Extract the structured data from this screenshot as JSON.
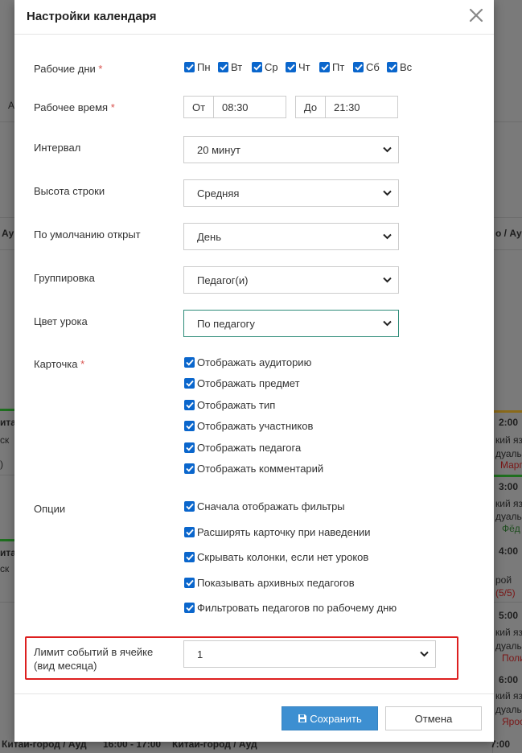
{
  "background": {
    "fragments": [
      "Ау",
      "А",
      "о / Ау",
      "ита",
      "ск",
      ")",
      "ита",
      "ск",
      "2:00",
      "кий яз",
      "дуалы",
      "Марг",
      "3:00",
      "кий яз",
      "дуаль",
      "Фёд",
      "4:00",
      "рой",
      "(5/5)",
      "5:00",
      "кий яз",
      "дуаль",
      "Поли",
      "6:00",
      "кий яз",
      "дуаль",
      "Ярос",
      "7:00",
      "Китай-город / Ауд",
      "16:00 - 17:00",
      "Китай-город / Ауд"
    ]
  },
  "modal": {
    "title": "Настройки календаря",
    "required_mark": "*",
    "workdays": {
      "label": "Рабочие дни",
      "days": [
        "Пн",
        "Вт",
        "Ср",
        "Чт",
        "Пт",
        "Сб",
        "Вс"
      ]
    },
    "worktime": {
      "label": "Рабочее время",
      "from_label": "От",
      "from_value": "08:30",
      "to_label": "До",
      "to_value": "21:30"
    },
    "interval": {
      "label": "Интервал",
      "value": "20 минут"
    },
    "row_height": {
      "label": "Высота строки",
      "value": "Средняя"
    },
    "default_open": {
      "label": "По умолчанию открыт",
      "value": "День"
    },
    "grouping": {
      "label": "Группировка",
      "value": "Педагог(и)"
    },
    "lesson_color": {
      "label": "Цвет урока",
      "value": "По педагогу"
    },
    "card": {
      "label": "Карточка",
      "options": [
        "Отображать аудиторию",
        "Отображать предмет",
        "Отображать тип",
        "Отображать участников",
        "Отображать педагога",
        "Отображать комментарий"
      ]
    },
    "options": {
      "label": "Опции",
      "items": [
        "Сначала отображать фильтры",
        "Расширять карточку при наведении",
        "Скрывать колонки, если нет уроков",
        "Показывать архивных педагогов",
        "Фильтровать педагогов по рабочему дню"
      ]
    },
    "event_limit": {
      "label_line1": "Лимит событий в ячейке",
      "label_line2": "(вид месяца)",
      "value": "1"
    },
    "save_label": "Сохранить",
    "cancel_label": "Отмена"
  },
  "colors": {
    "checkbox": "#0a66cc",
    "primary_button": "#3d8fd1",
    "required": "#d9534f",
    "highlight": "#dd1f1f",
    "focus_border": "#2c8b78"
  }
}
